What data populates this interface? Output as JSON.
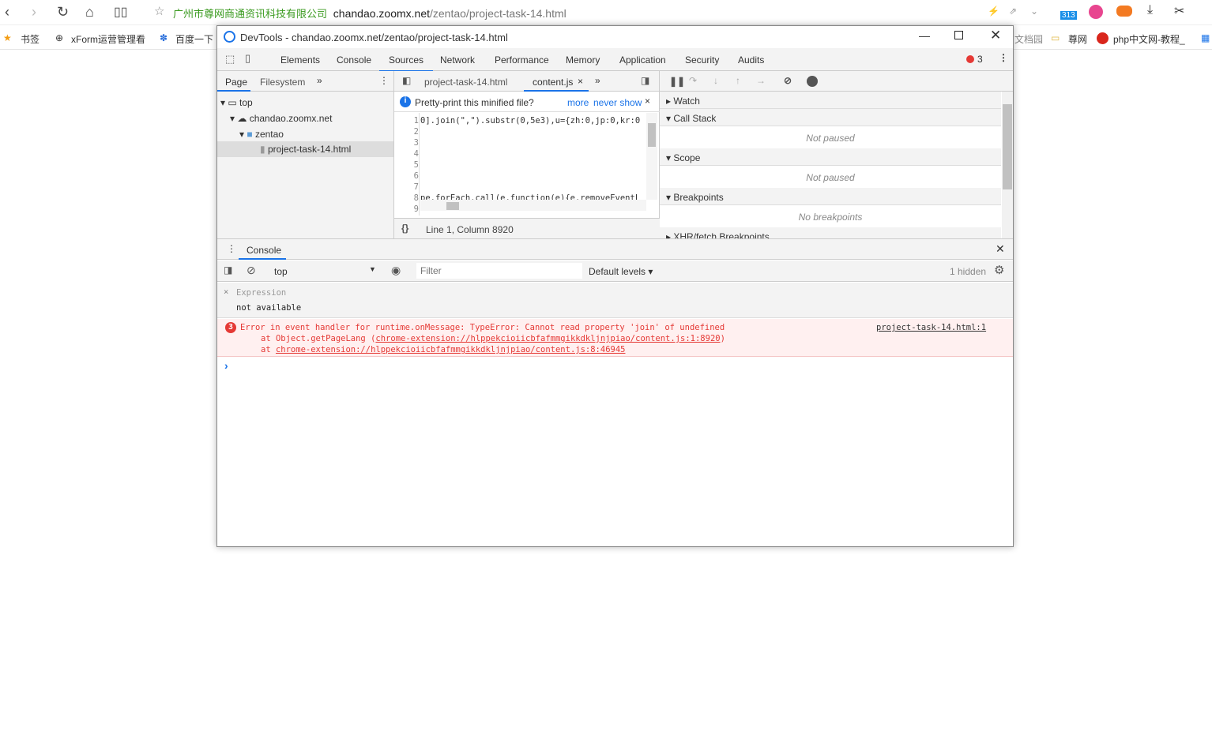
{
  "browser": {
    "company": "广州市尊网商通资讯科技有限公司",
    "url_host": "chandao.zoomx.net",
    "url_path": "/zentao/project-task-14.html",
    "badge": "313"
  },
  "bookmarks": [
    "书签",
    "xForm运营管理看",
    "百度一下",
    "文档园",
    "尊网",
    "php中文网-教程_"
  ],
  "devtools": {
    "title": "DevTools - chandao.zoomx.net/zentao/project-task-14.html",
    "tabs": [
      "Elements",
      "Console",
      "Sources",
      "Network",
      "Performance",
      "Memory",
      "Application",
      "Security",
      "Audits"
    ],
    "error_count": "3",
    "nav_tabs": [
      "Page",
      "Filesystem"
    ],
    "tree": [
      "top",
      "chandao.zoomx.net",
      "zentao",
      "project-task-14.html"
    ],
    "editor_tabs": [
      "project-task-14.html",
      "content.js"
    ],
    "prettyprint": {
      "text": "Pretty-print this minified file?",
      "more": "more",
      "never": "never show"
    },
    "code": {
      "lines": [
        "1",
        "2",
        "3",
        "4",
        "5",
        "6",
        "7",
        "8",
        "9"
      ],
      "line1": "0].join(\",\").substr(0,5e3),u={zh:0,jp:0,kr:0",
      "line8": "pe.forEach.call(e,function(e){e.removeEventL"
    },
    "status": "Line 1, Column 8920",
    "debugger": {
      "watch": "Watch",
      "callstack": "Call Stack",
      "not_paused": "Not paused",
      "scope": "Scope",
      "scope_empty": "Not paused",
      "breakpoints": "Breakpoints",
      "no_breakpoints": "No breakpoints",
      "xhr": "XHR/fetch Breakpoints"
    },
    "console": {
      "tab": "Console",
      "context": "top",
      "filter_placeholder": "Filter",
      "levels": "Default levels",
      "hidden": "1 hidden",
      "expression_label": "Expression",
      "expression_value": "not available",
      "error_count": "3",
      "error_msg": "Error in event handler for runtime.onMessage: TypeError: Cannot read property 'join' of undefined",
      "error_source": "project-task-14.html:1",
      "stack1_prefix": "at Object.getPageLang (",
      "stack1_link": "chrome-extension://hlppekcioiicbfafmmgikkdkljnjpiao/content.js:1:8920",
      "stack1_suffix": ")",
      "stack2_prefix": "at ",
      "stack2_link": "chrome-extension://hlppekcioiicbfafmmgikkdkljnjpiao/content.js:8:46945",
      "prompt": "›"
    }
  }
}
